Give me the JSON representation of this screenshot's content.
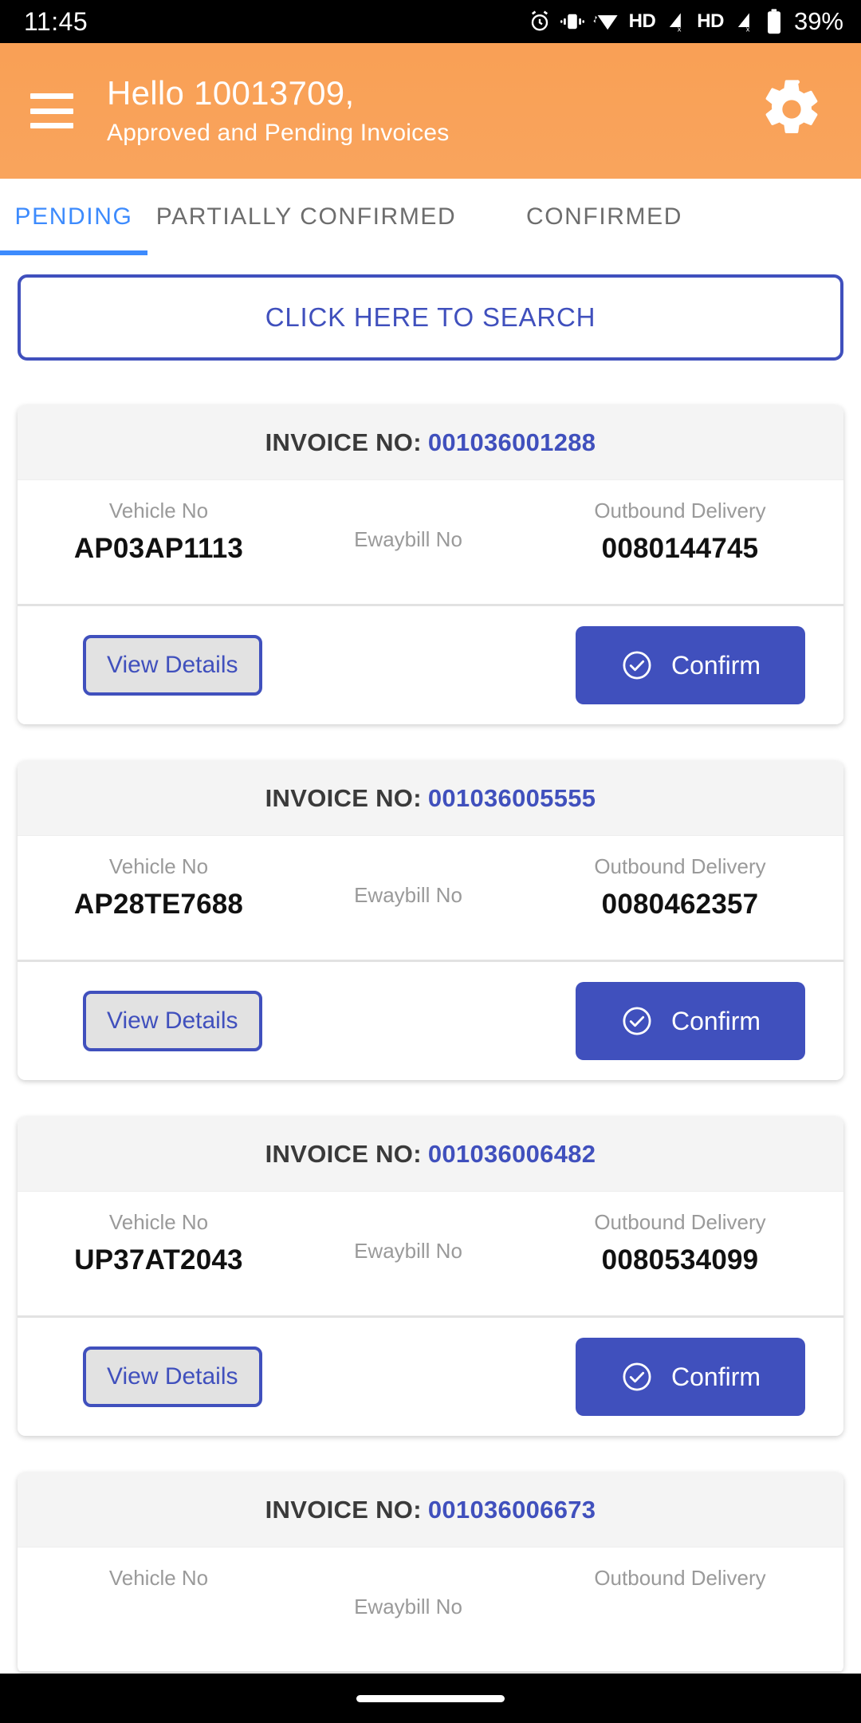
{
  "status_bar": {
    "time": "11:45",
    "battery_percent": "39%",
    "hd_label_1": "HD",
    "hd_label_2": "HD",
    "icons": [
      "alarm-icon",
      "vibrate-icon",
      "wifi-icon",
      "hd-icon",
      "signal-off-icon",
      "hd-icon",
      "signal-off-icon",
      "battery-icon"
    ]
  },
  "app_bar": {
    "menu_icon": "hamburger-menu-icon",
    "title": "Hello 10013709,",
    "subtitle": "Approved and Pending Invoices",
    "settings_icon": "gear-icon",
    "background_color": "#f9a055"
  },
  "tabs": {
    "items": [
      {
        "label": "PENDING",
        "active": true
      },
      {
        "label": "PARTIALLY CONFIRMED",
        "active": false
      },
      {
        "label": "CONFIRMED",
        "active": false
      }
    ],
    "active_color": "#3d8bfd",
    "inactive_color": "#6d6d6d"
  },
  "search": {
    "label": "CLICK HERE TO SEARCH",
    "accent_color": "#4050bd"
  },
  "card_labels": {
    "invoice_prefix": "INVOICE NO:",
    "vehicle_no": "Vehicle No",
    "ewaybill_no": "Ewaybill No",
    "outbound_delivery": "Outbound Delivery",
    "view_details": "View Details",
    "confirm": "Confirm",
    "confirm_icon": "check-circle-icon"
  },
  "invoices": [
    {
      "invoice_no": "001036001288",
      "vehicle_no": "AP03AP1113",
      "ewaybill_no": "",
      "outbound_delivery": "0080144745"
    },
    {
      "invoice_no": "001036005555",
      "vehicle_no": "AP28TE7688",
      "ewaybill_no": "",
      "outbound_delivery": "0080462357"
    },
    {
      "invoice_no": "001036006482",
      "vehicle_no": "UP37AT2043",
      "ewaybill_no": "",
      "outbound_delivery": "0080534099"
    },
    {
      "invoice_no": "001036006673",
      "vehicle_no": "",
      "ewaybill_no": "",
      "outbound_delivery": ""
    }
  ],
  "nav_bar": {
    "home_indicator": "home-indicator"
  }
}
